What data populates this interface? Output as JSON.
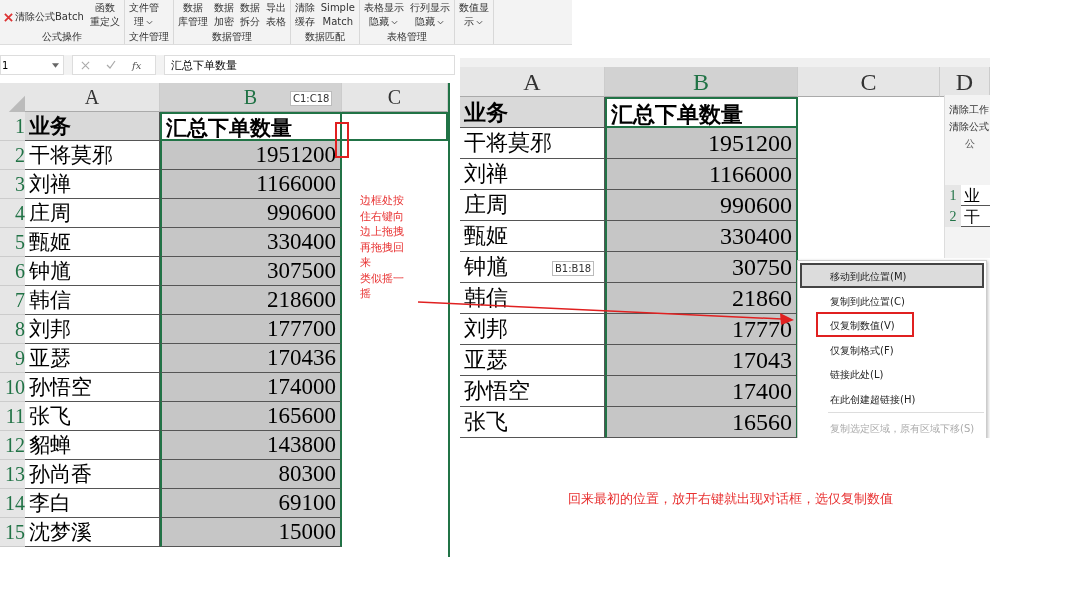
{
  "left_window": {
    "ribbon": {
      "groups": [
        {
          "label": "公式操作",
          "items": [
            {
              "kind": "small",
              "lines": [
                "清除公式Batch"
              ]
            },
            {
              "kind": "large",
              "lines": [
                "函数",
                "重定义"
              ],
              "dropdown": false
            }
          ]
        },
        {
          "label": "文件管理",
          "items": [
            {
              "kind": "large",
              "lines": [
                "文件管",
                "理"
              ],
              "dropdown": true
            }
          ]
        },
        {
          "label": "数据管理",
          "items": [
            {
              "kind": "large",
              "lines": [
                "数据",
                "库管理"
              ],
              "dropdown": false
            },
            {
              "kind": "large",
              "lines": [
                "数据",
                "加密"
              ],
              "dropdown": false
            },
            {
              "kind": "large",
              "lines": [
                "数据",
                "拆分"
              ],
              "dropdown": false
            },
            {
              "kind": "large",
              "lines": [
                "导出",
                "表格"
              ],
              "dropdown": false
            }
          ]
        },
        {
          "label": "数据匹配",
          "items": [
            {
              "kind": "large",
              "lines": [
                "清除",
                "缓存"
              ],
              "dropdown": false
            },
            {
              "kind": "large",
              "lines": [
                "Simple",
                "Match"
              ],
              "dropdown": false
            }
          ]
        },
        {
          "label": "表格管理",
          "items": [
            {
              "kind": "large",
              "lines": [
                "表格显示",
                "隐藏"
              ],
              "dropdown": true
            },
            {
              "kind": "large",
              "lines": [
                "行列显示",
                "隐藏"
              ],
              "dropdown": true
            }
          ]
        },
        {
          "items": [
            {
              "kind": "large",
              "lines": [
                "数值显",
                "示"
              ],
              "dropdown": true
            }
          ]
        }
      ]
    },
    "formula_bar": {
      "name_box": "1",
      "function_label": "fx",
      "value": "汇总下单数量"
    },
    "sheet": {
      "columns": [
        {
          "label": "A",
          "selected": false
        },
        {
          "label": "B",
          "selected": true
        },
        {
          "label": "C",
          "selected": false
        }
      ],
      "range_tip": "C1:C18",
      "rows": [
        {
          "num": "1",
          "a": "业务",
          "b": "汇总下单数量"
        },
        {
          "num": "2",
          "a": "干将莫邪",
          "b": "1951200"
        },
        {
          "num": "3",
          "a": "刘禅",
          "b": "1166000"
        },
        {
          "num": "4",
          "a": "庄周",
          "b": "990600"
        },
        {
          "num": "5",
          "a": "甄姬",
          "b": "330400"
        },
        {
          "num": "6",
          "a": "钟馗",
          "b": "307500"
        },
        {
          "num": "7",
          "a": "韩信",
          "b": "218600"
        },
        {
          "num": "8",
          "a": "刘邦",
          "b": "177700"
        },
        {
          "num": "9",
          "a": "亚瑟",
          "b": "170436"
        },
        {
          "num": "10",
          "a": "孙悟空",
          "b": "174000"
        },
        {
          "num": "11",
          "a": "张飞",
          "b": "165600"
        },
        {
          "num": "12",
          "a": "貂蝉",
          "b": "143800"
        },
        {
          "num": "13",
          "a": "孙尚香",
          "b": "80300"
        },
        {
          "num": "14",
          "a": "李白",
          "b": "69100"
        },
        {
          "num": "15",
          "a": "沈梦溪",
          "b": "15000"
        }
      ]
    }
  },
  "annotation_left": [
    "边框处按住右键向边上拖拽再拖拽回来",
    "类似摇一摇"
  ],
  "right_window": {
    "sheet": {
      "columns": [
        {
          "label": "A",
          "selected": false
        },
        {
          "label": "B",
          "selected": true
        },
        {
          "label": "C",
          "selected": false
        },
        {
          "label": "D",
          "selected": false
        }
      ],
      "range_tip": "B1:B18",
      "rows": [
        {
          "a": "业务",
          "b": "汇总下单数量"
        },
        {
          "a": "干将莫邪",
          "b": "1951200"
        },
        {
          "a": "刘禅",
          "b": "1166000"
        },
        {
          "a": "庄周",
          "b": "990600"
        },
        {
          "a": "甄姬",
          "b": "330400"
        },
        {
          "a": "钟馗",
          "b": "30750"
        },
        {
          "a": "韩信",
          "b": "21860"
        },
        {
          "a": "刘邦",
          "b": "17770"
        },
        {
          "a": "亚瑟",
          "b": "17043"
        },
        {
          "a": "孙悟空",
          "b": "17400"
        },
        {
          "a": "张飞",
          "b": "16560"
        }
      ]
    },
    "inset": {
      "ribbon_items": [
        "清除工作",
        "清除公式"
      ],
      "group_label": "公",
      "rows": [
        {
          "num": "1",
          "a": "业"
        },
        {
          "num": "2",
          "a": "干"
        }
      ]
    },
    "context_menu": [
      {
        "label": "移动到此位置(M)",
        "selected": true,
        "disabled": false,
        "marked": false
      },
      {
        "label": "复制到此位置(C)",
        "selected": false,
        "disabled": false,
        "marked": false
      },
      {
        "label": "仅复制数值(V)",
        "selected": false,
        "disabled": false,
        "marked": true
      },
      {
        "label": "仅复制格式(F)",
        "selected": false,
        "disabled": false,
        "marked": false
      },
      {
        "label": "链接此处(L)",
        "selected": false,
        "disabled": false,
        "marked": false
      },
      {
        "label": "在此创建超链接(H)",
        "selected": false,
        "disabled": false,
        "marked": false
      },
      {
        "label": "复制选定区域，原有区域下移(S)",
        "selected": false,
        "disabled": true,
        "marked": false
      }
    ]
  },
  "annotation_bottom": "回来最初的位置，放开右键就出现对话框，选仅复制数值"
}
